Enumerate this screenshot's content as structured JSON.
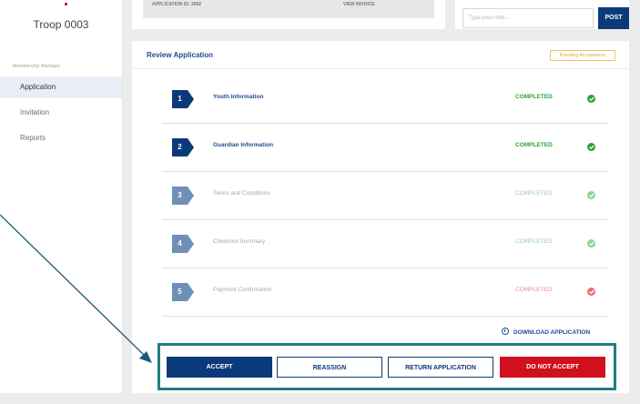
{
  "sidebar": {
    "title": "Troop 0003",
    "section_label": "Membership Manager",
    "items": [
      {
        "label": "Application",
        "active": true
      },
      {
        "label": "Invitation",
        "active": false
      },
      {
        "label": "Reports",
        "active": false
      }
    ]
  },
  "top_card": {
    "application_id": "APPLICATION ID: 3092",
    "view_invoice": "VIEW INVOICE"
  },
  "post_box": {
    "placeholder": "Type your note...",
    "button_label": "POST"
  },
  "review": {
    "title": "Review Application",
    "badge": "Pending Acceptance",
    "steps": [
      {
        "number": "1",
        "label": "Youth Information",
        "status": "COMPLETED"
      },
      {
        "number": "2",
        "label": "Guardian Information",
        "status": "COMPLETED"
      },
      {
        "number": "3",
        "label": "Terms and Conditions",
        "status": "COMPLETED"
      },
      {
        "number": "4",
        "label": "Checkout Summary",
        "status": "COMPLETED"
      },
      {
        "number": "5",
        "label": "Payment Confirmation",
        "status": "COMPLETED"
      }
    ],
    "download_label": "DOWNLOAD APPLICATION"
  },
  "actions": {
    "accept": "ACCEPT",
    "reassign": "REASSIGN",
    "return": "RETURN APPLICATION",
    "reject": "DO NOT ACCEPT"
  },
  "colors": {
    "primary": "#0b3a7a",
    "success": "#2aa23a",
    "danger": "#d0101e",
    "pending": "#e7a631",
    "highlight": "#1e8083"
  }
}
